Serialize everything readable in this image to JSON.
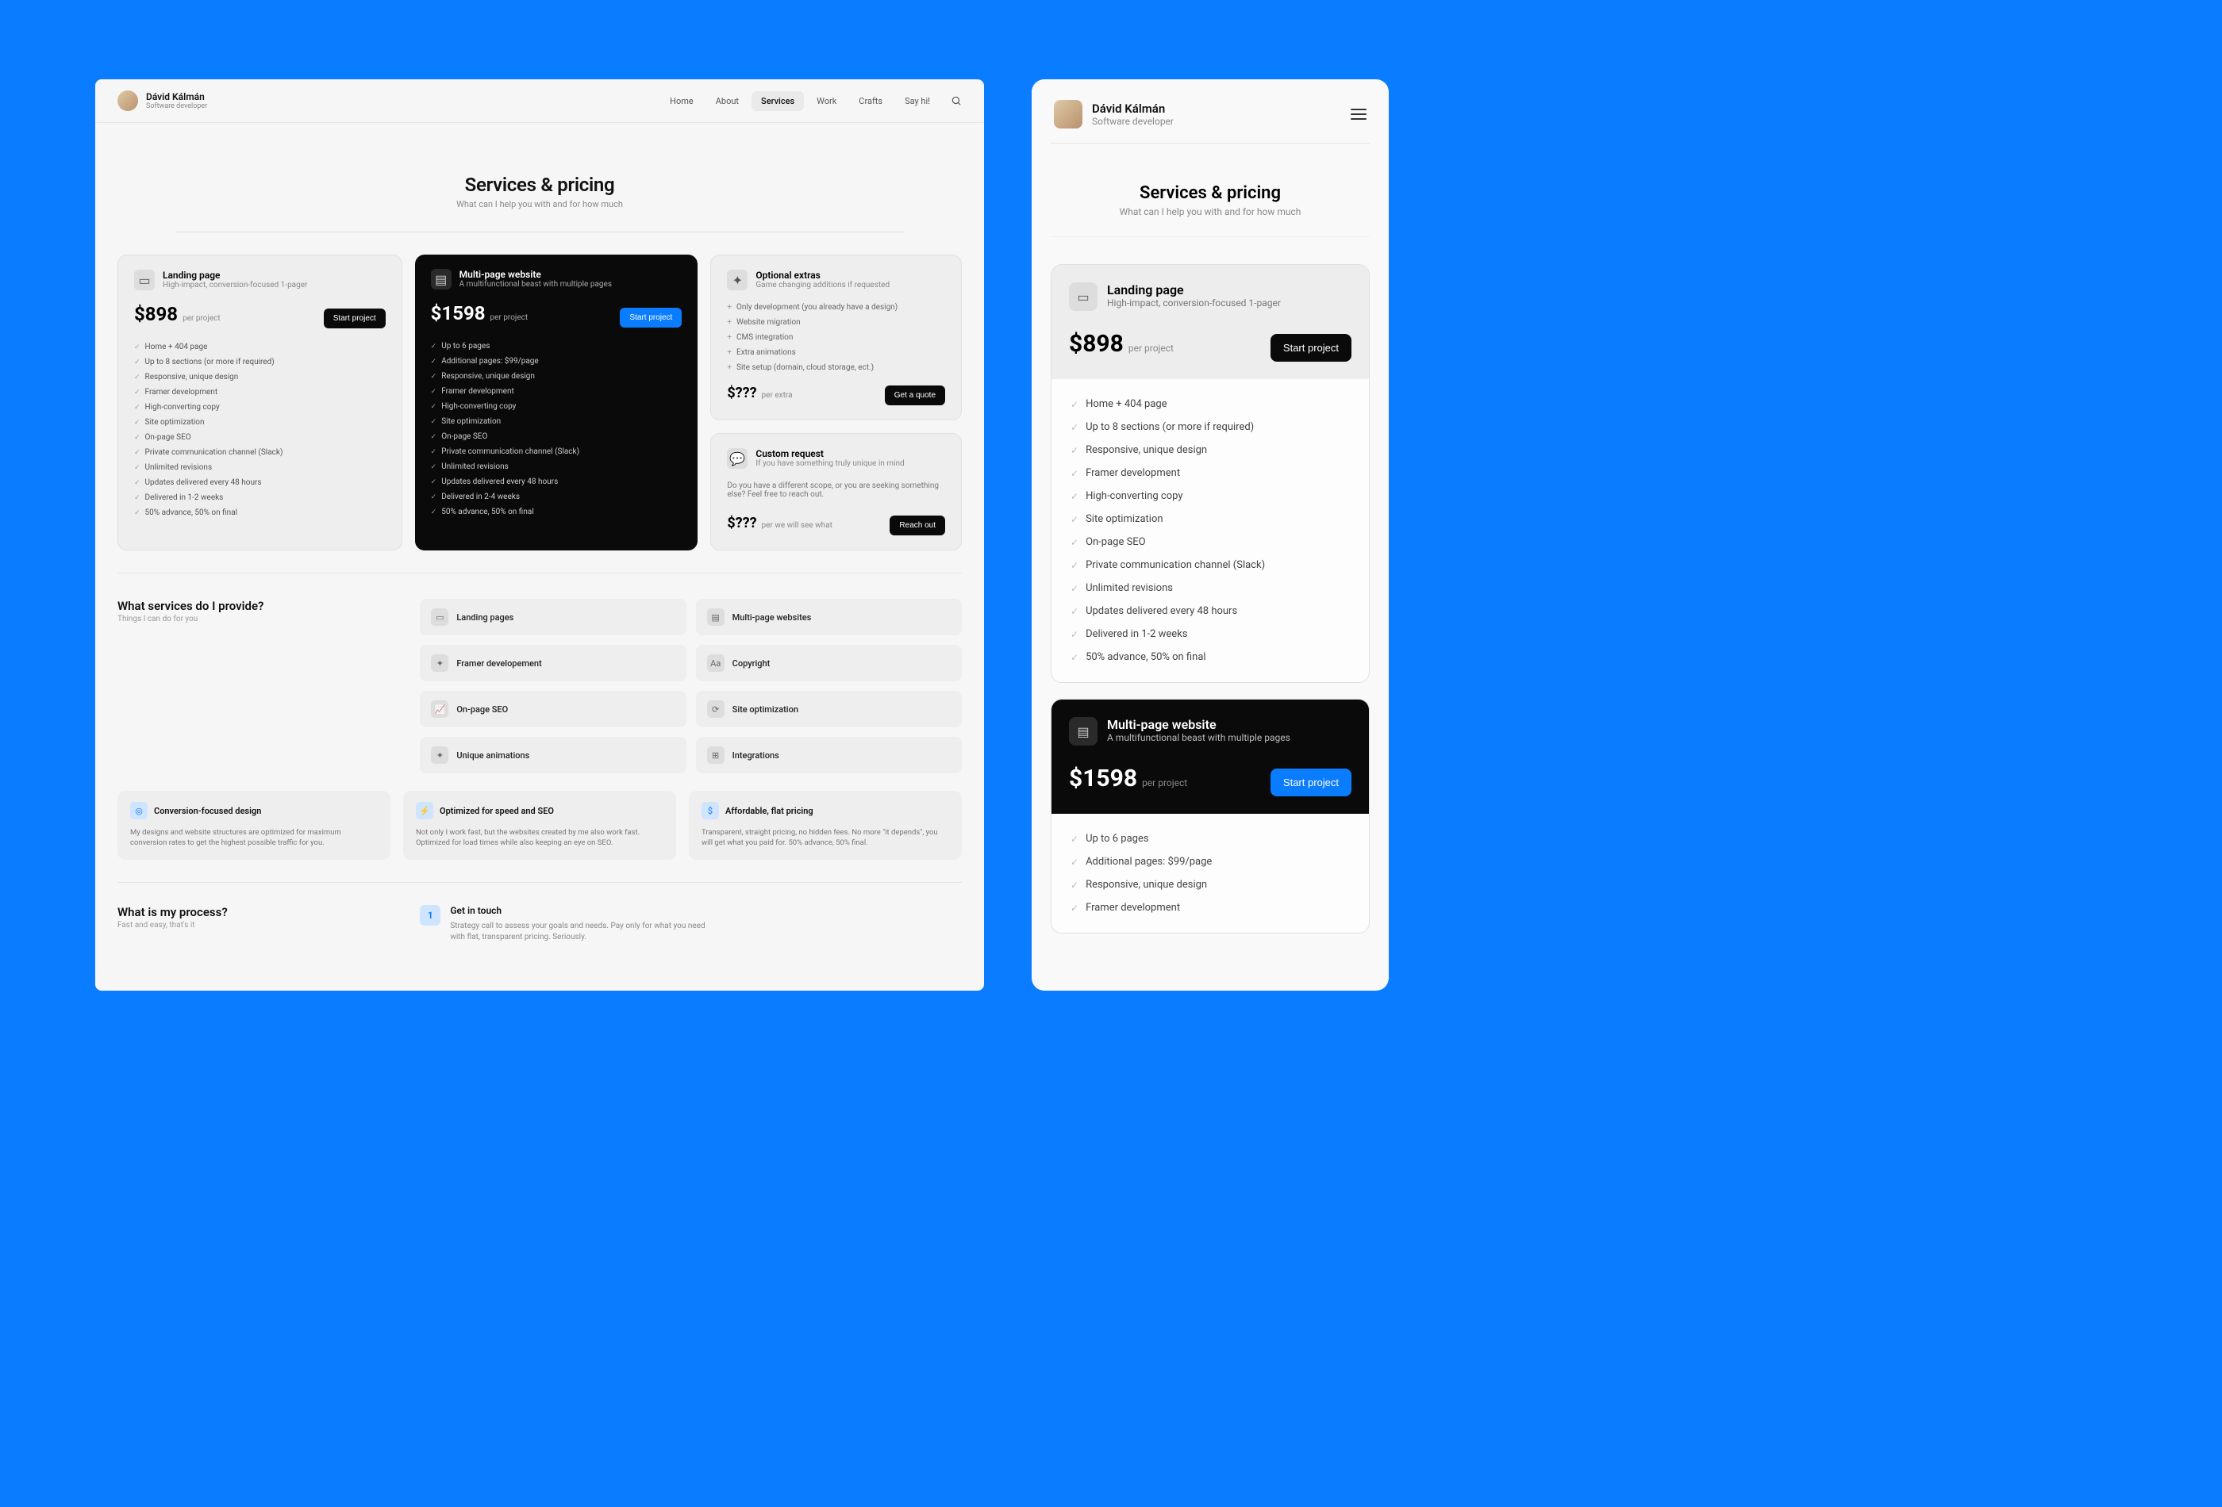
{
  "brand": {
    "name": "Dávid Kálmán",
    "role": "Software developer"
  },
  "nav": {
    "items": [
      "Home",
      "About",
      "Services",
      "Work",
      "Crafts",
      "Say hi!"
    ],
    "active": "Services"
  },
  "hero": {
    "title": "Services & pricing",
    "subtitle": "What can I help you with and for how much"
  },
  "pricing": {
    "landing": {
      "title": "Landing page",
      "subtitle": "High-impact, conversion-focused 1-pager",
      "price": "$898",
      "unit": "per project",
      "cta": "Start project",
      "features": [
        "Home + 404 page",
        "Up to 8 sections (or more if required)",
        "Responsive, unique design",
        "Framer development",
        "High-converting copy",
        "Site optimization",
        "On-page SEO",
        "Private communication channel (Slack)",
        "Unlimited revisions",
        "Updates delivered every 48 hours",
        "Delivered in 1-2 weeks",
        "50% advance, 50% on final"
      ]
    },
    "multipage": {
      "title": "Multi-page website",
      "subtitle": "A multifunctional beast with multiple pages",
      "price": "$1598",
      "unit": "per project",
      "cta": "Start project",
      "features": [
        "Up to 6 pages",
        "Additional pages: $99/page",
        "Responsive, unique design",
        "Framer development",
        "High-converting copy",
        "Site optimization",
        "On-page SEO",
        "Private communication channel (Slack)",
        "Unlimited revisions",
        "Updates delivered every 48 hours",
        "Delivered in 2-4 weeks",
        "50% advance, 50% on final"
      ]
    },
    "extras": {
      "title": "Optional extras",
      "subtitle": "Game changing additions if requested",
      "items": [
        "Only development (you already have a design)",
        "Website migration",
        "CMS integration",
        "Extra animations",
        "Site setup (domain, cloud storage, ect.)"
      ],
      "price": "$???",
      "unit": "per extra",
      "cta": "Get a quote"
    },
    "custom": {
      "title": "Custom request",
      "subtitle": "If you have something truly unique in mind",
      "body": "Do you have a different scope, or you are seeking something else? Feel free to reach out.",
      "price": "$???",
      "unit": "per we will see what",
      "cta": "Reach out"
    }
  },
  "services_section": {
    "title": "What services do I provide?",
    "subtitle": "Things I can do for you",
    "chips": [
      "Landing pages",
      "Multi-page websites",
      "Framer developement",
      "Copyright",
      "On-page SEO",
      "Site optimization",
      "Unique animations",
      "Integrations"
    ],
    "trio": [
      {
        "title": "Conversion-focused design",
        "body": "My designs and website structures are optimized for maximum conversion rates to get the highest possible traffic for you."
      },
      {
        "title": "Optimized for speed and SEO",
        "body": "Not only I work fast, but the websites created by me also work fast. Optimized for load times while also keeping an eye on SEO."
      },
      {
        "title": "Affordable, flat pricing",
        "body": "Transparent, straight pricing, no hidden fees. No more \"it depends\", you will get what you paid for. 50% advance, 50% final."
      }
    ]
  },
  "process": {
    "title": "What is my process?",
    "subtitle": "Fast and easy, that's it",
    "step1": {
      "num": "1",
      "title": "Get in touch",
      "body": "Strategy call to assess your goals and needs. Pay only for what you need with flat, transparent pricing. Seriously."
    }
  },
  "chip_icons": [
    "▭",
    "▤",
    "✦",
    "Aa",
    "📈",
    "⟳",
    "✦",
    "⊞"
  ],
  "trio_icons": [
    "◎",
    "⚡",
    "$"
  ]
}
